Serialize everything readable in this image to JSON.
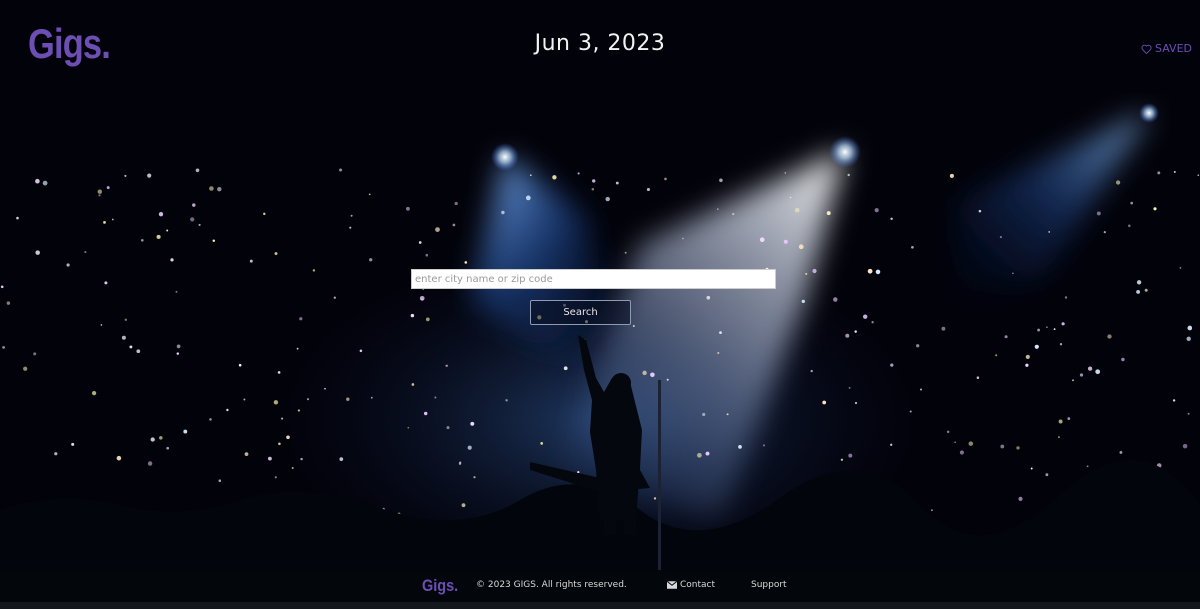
{
  "header": {
    "logo": "Gigs.",
    "date": "Jun 3, 2023",
    "saved_label": "SAVED"
  },
  "search": {
    "placeholder": "enter city name or zip code",
    "value": "",
    "button_label": "Search"
  },
  "footer": {
    "logo": "Gigs.",
    "copyright": "© 2023 GIGS. All rights reserved.",
    "contact_label": "Contact",
    "support_label": "Support"
  },
  "icons": {
    "saved": "heart-outline-icon",
    "contact": "envelope-icon"
  },
  "colors": {
    "brand": "#6d4fb4",
    "background": "#02020a"
  }
}
